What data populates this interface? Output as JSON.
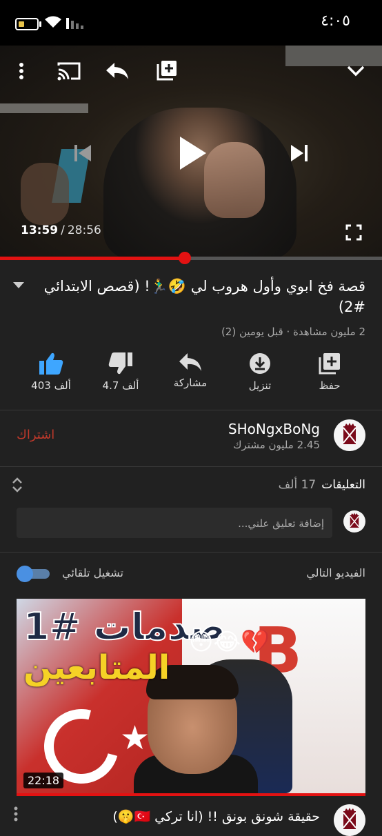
{
  "status_bar": {
    "time": "٤:٠٥"
  },
  "player": {
    "current_time": "13:59",
    "separator": "/",
    "total_time": "28:56",
    "progress": 0.483,
    "accent_color": "#e21212"
  },
  "video": {
    "title": "قصة فخ ابوي وأول هروب لي 🤣🏃‍♂️! (قصص الابتدائي #2)",
    "meta": "2 مليون مشاهدة · قبل يومين (2)"
  },
  "actions": [
    {
      "icon": "thumbs-up-icon",
      "label": "403 ألف"
    },
    {
      "icon": "thumbs-down-icon",
      "label": "4.7 ألف"
    },
    {
      "icon": "share-icon",
      "label": "مشاركة"
    },
    {
      "icon": "download-icon",
      "label": "تنزيل"
    },
    {
      "icon": "save-playlist-icon",
      "label": "حفظ"
    }
  ],
  "channel": {
    "name": "SHoNgxBoNg",
    "subscribers": "2.45 مليون مشترك",
    "subscribe_label": "اشتراك"
  },
  "comments": {
    "label": "التعليقات",
    "count": "17 ألف",
    "placeholder": "إضافة تعليق علني..."
  },
  "up_next": {
    "label": "الفيديو التالي",
    "autoplay_label": "تشغيل تلقائي",
    "autoplay_on": true,
    "thumbnail_text_1": "صدمات #1",
    "thumbnail_text_2": "المتابعين",
    "thumbnail_letter": "B",
    "thumbnail_emoji": "😳😂💔",
    "duration": "22:18",
    "title": "حقيقة شونق بونق !! (انا تركي 🇹🇷🤫)"
  }
}
